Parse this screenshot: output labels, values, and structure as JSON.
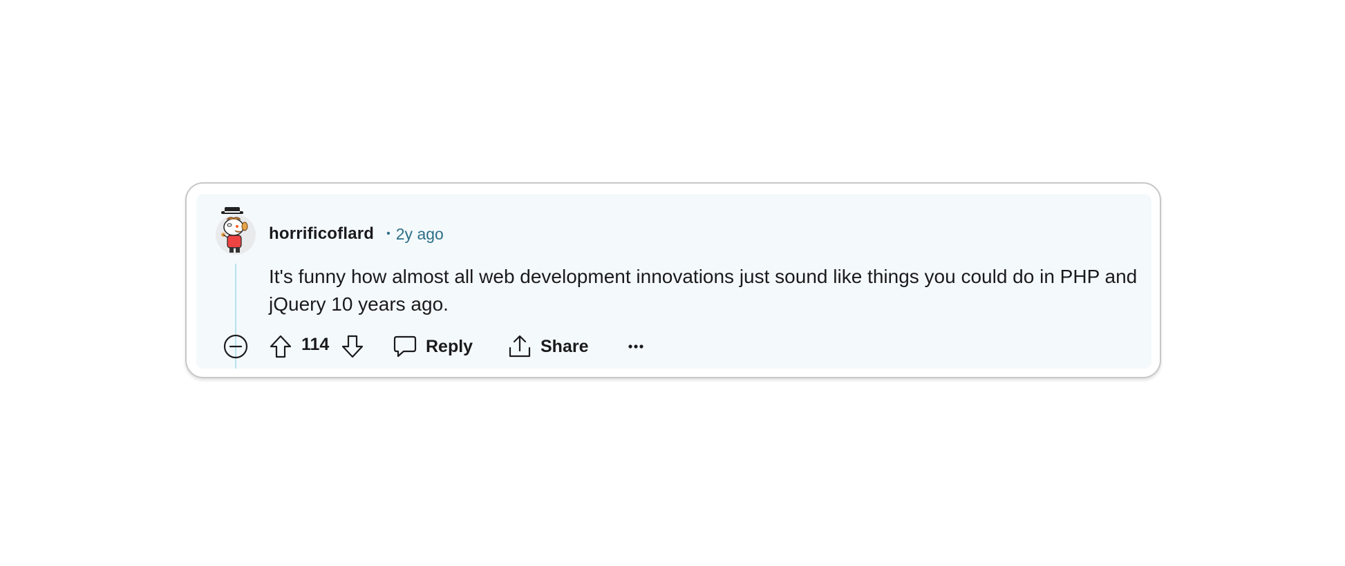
{
  "comment": {
    "username": "horrificoflard",
    "separator": "•",
    "timestamp": "2y ago",
    "body": "It's funny how almost all web development innovations just sound like things you could do in PHP and jQuery 10 years ago.",
    "avatar_icon": "user-avatar-icon"
  },
  "actions": {
    "collapse_icon": "collapse-minus-icon",
    "upvote_icon": "upvote-arrow-icon",
    "score": "114",
    "downvote_icon": "downvote-arrow-icon",
    "reply_label": "Reply",
    "reply_icon": "speech-bubble-icon",
    "share_label": "Share",
    "share_icon": "share-upload-icon",
    "more_label": "···",
    "more_icon": "ellipsis-icon"
  },
  "colors": {
    "comment_background": "#f4f9fc",
    "thread_line": "#b8e2f0",
    "timestamp": "#2b6f86",
    "text": "#1a1a1b",
    "card_border": "#c7c7c7"
  }
}
